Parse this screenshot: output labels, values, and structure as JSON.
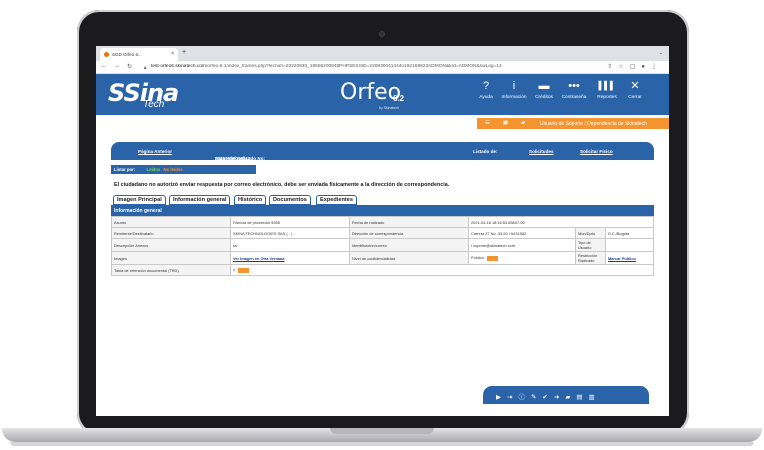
{
  "browser": {
    "tab_title": "SGD Orfeo 6...",
    "tab_close": "×",
    "new_tab": "+",
    "url_host": "test-orfeo6.skinatech.com",
    "url_path": "/orfeo-6.1/index_frames.php?fechah=20220830_18586200848PHPSESSID=220830041444o192168823ADMON&krd=ADMON&swLog=14"
  },
  "header": {
    "brand_main": "Sina",
    "brand_sub": "Tech",
    "product": "Orfeo",
    "product_version": "6.2",
    "product_by": "by Skinatech",
    "menu": [
      {
        "icon": "question-icon",
        "glyph": "?",
        "label": "Ayuda"
      },
      {
        "icon": "info-icon",
        "glyph": "i",
        "label": "Información"
      },
      {
        "icon": "credits-icon",
        "glyph": "▬",
        "label": "Créditos"
      },
      {
        "icon": "more-icon",
        "glyph": "•••",
        "label": "Contraseña"
      },
      {
        "icon": "bar-chart-icon",
        "glyph": "▌▌▌",
        "label": "Reportes"
      },
      {
        "icon": "close-icon",
        "glyph": "✕",
        "label": "Cerrar"
      }
    ]
  },
  "userbar": {
    "text": "Usuario de Soporte | Dependencia de Skinatech"
  },
  "record_header": {
    "prev_page": "Página Anterior",
    "record_label": "Datos del radicado No:",
    "record_number": "20219980000112",
    "list_label": "Listado de:",
    "requests": "Solicitudes",
    "physical_request": "Solicitar Físico"
  },
  "filter": {
    "label": "Listar por:",
    "read": "Leídos",
    "unread": "No leídos"
  },
  "notice": "El ciudadano no autorizó enviar respuesta por correo electrónico, debe ser enviada físicamente a la dirección de correspondencia.",
  "tabs": [
    {
      "label": "Imagen Principal"
    },
    {
      "label": "Información general"
    },
    {
      "label": "Histórico"
    },
    {
      "label": "Documentos"
    },
    {
      "label": "Expedientes"
    }
  ],
  "section_title": "Información general",
  "info": {
    "asunto_label": "Asunto",
    "asunto_value": "Factura de proveedor 5555",
    "fecha_label": "Fecha de radicado",
    "fecha_value": "2021-04-16 18:16:53.83807-05",
    "remitente_label": "Remitente/Destinatario",
    "remitente_value": "SKINA TECHNOLOGIES SAS ( - )",
    "direccion_label": "Dirección de correspondencia",
    "direccion_value": "Carrera 37 No. 53-50 / 6431582",
    "mun_label": "Mun/Dpto",
    "mun_value": "D.C./Bogota",
    "descripcion_label": "Descripción Anexos",
    "descripcion_value": "ss",
    "identificacion_label": "Identificación/correo",
    "identificacion_value": "/ soporte@skinatech.com",
    "tipo_label": "Tipo de Usuario",
    "tipo_value": "",
    "imagen_label": "Imagen",
    "imagen_link": "Ver Imagen en Otra Ventana",
    "nivel_label": "Nivel de confidencialidad",
    "nivel_value": "Público",
    "restriccion_label": "Restricción Radicado",
    "restriccion_link": "Marcar Público",
    "trd_label": "Tabla de retención documental (TRD)",
    "trd_value": "//"
  },
  "bottom_tools": [
    "play-icon",
    "login-icon",
    "info-icon",
    "edit-icon",
    "check-icon",
    "share-icon",
    "folder-icon",
    "pdf-icon",
    "trash-icon"
  ],
  "colors": {
    "primary": "#2a63a8",
    "accent": "#f39530",
    "read_green": "#7ed957"
  }
}
